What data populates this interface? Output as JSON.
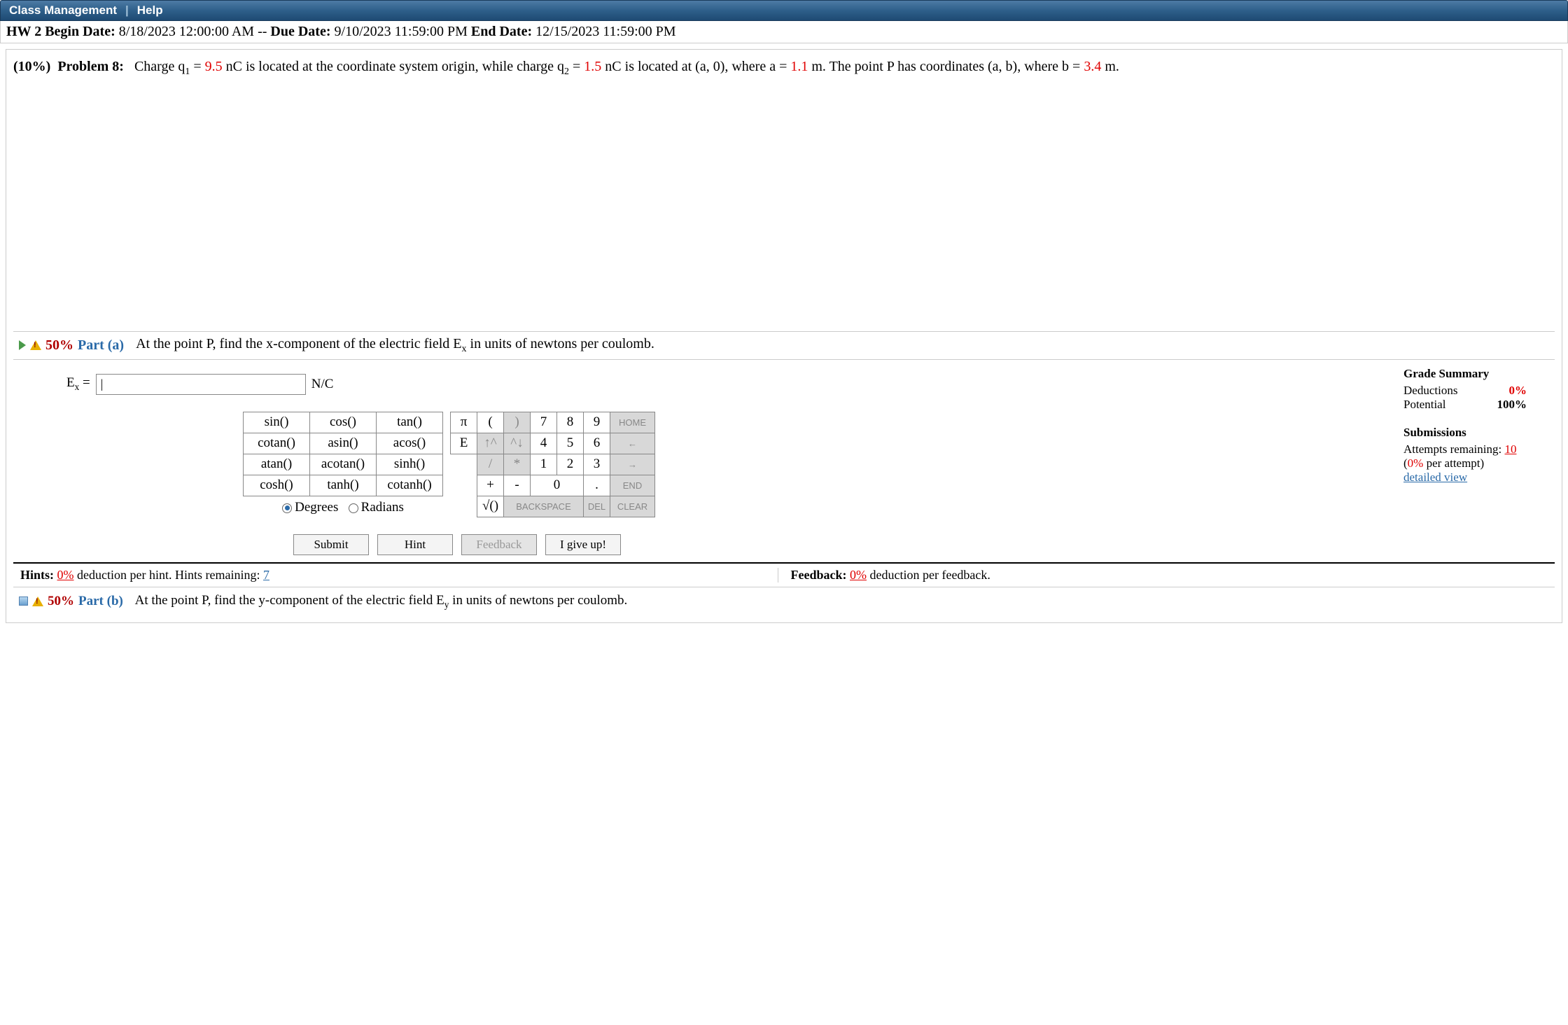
{
  "topbar": {
    "link1": "Class Management",
    "link2": "Help"
  },
  "hw": {
    "prefix": "HW 2 Begin Date: ",
    "begin": "8/18/2023 12:00:00 AM",
    "mid": " -- ",
    "dueLabel": "Due Date: ",
    "due": "9/10/2023 11:59:00 PM ",
    "endLabel": "End Date: ",
    "end": "12/15/2023 11:59:00 PM"
  },
  "problem": {
    "pct": "(10%)",
    "label": "Problem 8:",
    "t1": "Charge q",
    "sub1": "1",
    "t2": " = ",
    "q1": "9.5",
    "t3": " nC is located at the coordinate system origin, while charge q",
    "sub2": "2",
    "t4": " = ",
    "q2": "1.5",
    "t5": " nC is located at (a, 0), where a = ",
    "aval": "1.1",
    "t6": " m. The point P has coordinates (a, b), where b = ",
    "bval": "3.4",
    "t7": " m."
  },
  "partA": {
    "pct": "50%",
    "label": "Part (a)",
    "text1": "At the point P, find the x-component of the electric field E",
    "sub": "x",
    "text2": " in units of newtons per coulomb.",
    "eqL": "E",
    "eqSub": "x",
    "eq": " = ",
    "unit": "N/C"
  },
  "func": [
    [
      "sin()",
      "cos()",
      "tan()"
    ],
    [
      "cotan()",
      "asin()",
      "acos()"
    ],
    [
      "atan()",
      "acotan()",
      "sinh()"
    ],
    [
      "cosh()",
      "tanh()",
      "cotanh()"
    ]
  ],
  "angle": {
    "deg": "Degrees",
    "rad": "Radians"
  },
  "numpad": {
    "pi": "π",
    "lp": "(",
    "rp": ")",
    "n7": "7",
    "n8": "8",
    "n9": "9",
    "home": "HOME",
    "E": "E",
    "up": "↑^",
    "dn": "^↓",
    "n4": "4",
    "n5": "5",
    "n6": "6",
    "left": "←",
    "sl": "/",
    "st": "*",
    "n1": "1",
    "n2": "2",
    "n3": "3",
    "right": "→",
    "plus": "+",
    "minus": "-",
    "n0": "0",
    "dot": ".",
    "end": "END",
    "sqrt": "√()",
    "bs": "BACKSPACE",
    "del": "DEL",
    "clr": "CLEAR"
  },
  "actions": {
    "submit": "Submit",
    "hint": "Hint",
    "feedback": "Feedback",
    "giveup": "I give up!"
  },
  "grade": {
    "title": "Grade Summary",
    "dedL": "Deductions",
    "dedV": "0%",
    "potL": "Potential",
    "potV": "100%",
    "subT": "Submissions",
    "attL": "Attempts remaining: ",
    "attV": "10",
    "perL": "(",
    "perV": "0%",
    "perR": " per attempt)",
    "detail": "detailed view"
  },
  "hints": {
    "hL1": "Hints: ",
    "hV": "0%",
    "hL2": " deduction per hint. Hints remaining: ",
    "hRem": "7",
    "fL1": "Feedback: ",
    "fV": "0%",
    "fL2": " deduction per feedback."
  },
  "partB": {
    "pct": "50%",
    "label": "Part (b)",
    "text1": "At the point P, find the y-component of the electric field E",
    "sub": "y",
    "text2": " in units of newtons per coulomb."
  }
}
